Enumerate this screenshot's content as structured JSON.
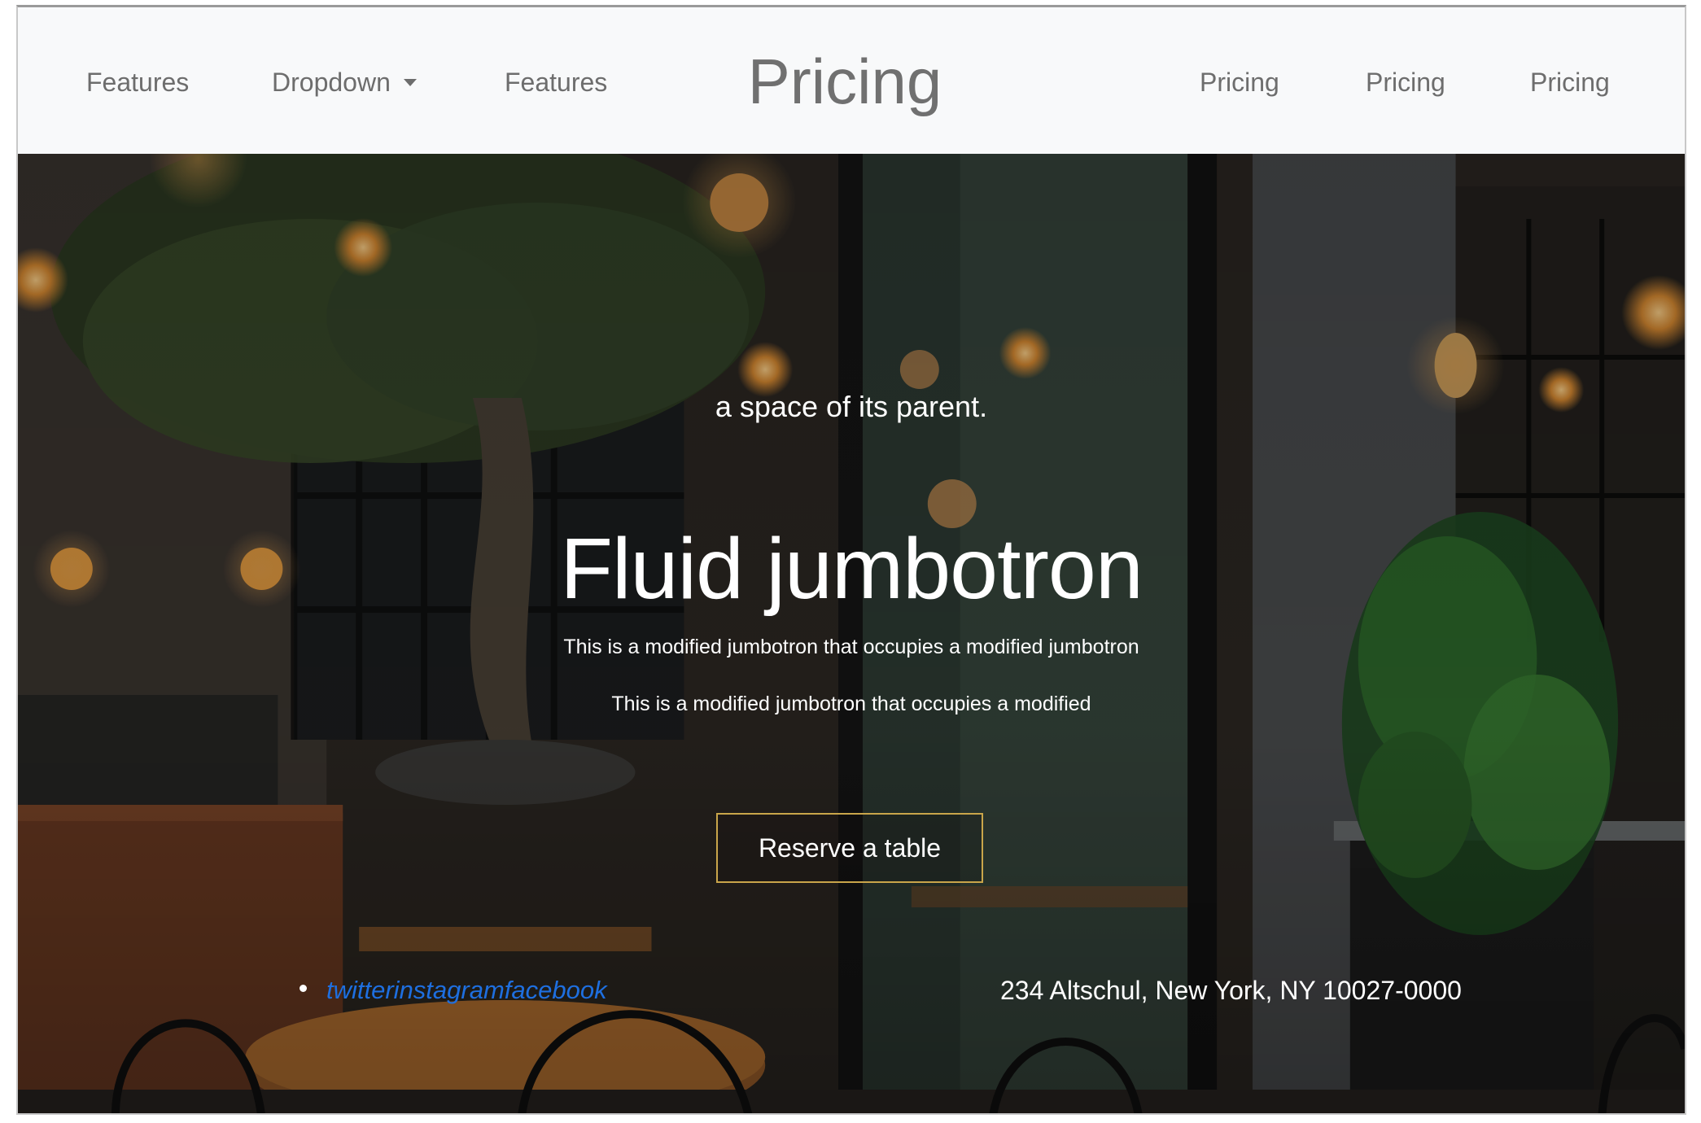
{
  "navbar": {
    "links": [
      "Features",
      "Dropdown",
      "Features",
      "Pricing",
      "Pricing",
      "Pricing"
    ],
    "brand": "Pricing",
    "dropdown_icon": "chevron-down-icon"
  },
  "hero": {
    "tagline": "a space of its parent.",
    "title": "Fluid jumbotron",
    "lead_1": "This is a modified jumbotron that occupies a modified jumbotron",
    "lead_2": "This is a modified jumbotron that occupies a modified",
    "cta_label": "Reserve a table",
    "accent_color": "#c9a54a"
  },
  "footer": {
    "social_text": "twitterinstagramfacebook",
    "social_link_color": "#1e6fe0",
    "address": "234 Altschul, New York, NY 10027-0000"
  }
}
